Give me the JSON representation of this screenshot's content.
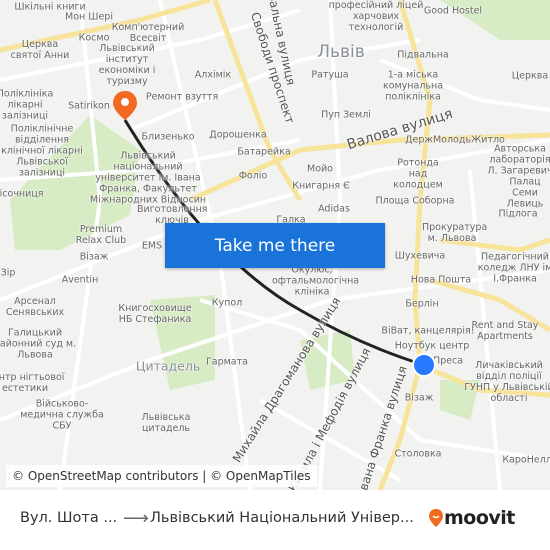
{
  "map": {
    "labels": [
      "Шкільні книги",
      "Мон Шері",
      "Комп'ютерний Всесвіт",
      "Космо",
      "Церква святої Анни",
      "Львівський інститут економіки і туризму",
      "Алхімік",
      "Поліклініка лікарні залізниці",
      "Satirikon",
      "Ремонт взуття",
      "Поліклінічне відділення клінічної лікарні Львівської залізниці",
      "Близенько",
      "Дорошенка",
      "Батарейка",
      "Львівський національний університет ім. Івана Франка, Факультет Міжнародних Відносин",
      "Фоліо",
      "Пісочниця",
      "Виготовлення ключів",
      "Premium Relax Club",
      "EMS",
      "Візаж",
      "Аventін",
      "Арсенал Сенявських",
      "Галицький районний суд м. Львова",
      "Центр нігтьової естетики",
      "Військово-медична служба СБУ",
      "Книгосховище НБ Стефаника",
      "Купол",
      "Цитадель",
      "Гармата",
      "Львівська цитадель",
      "Львівський професійний ліцей харчових технологій",
      "Good Hostel",
      "Львів",
      "Підвальна",
      "Ратуша",
      "1-а міська комунальна поліклініка",
      "Пуп Землі",
      "ДержМолодьЖитло",
      "Мойо",
      "Ротонда над колодцем",
      "Книгарня Є",
      "Площа Соборна",
      "Adidas",
      "Галка",
      "Прокуратура м. Львова",
      "Підлога",
      "Авторська лабораторія Л. Загаревич",
      "Палац Семи Левиць",
      "Церква",
      "Шухевича",
      "Педагогічний коледж ЛНУ ім І.Франка",
      "Окулюс, офтальмологічна клініка",
      "Нова Пошта",
      "Берлін",
      "ВіВат, канцелярія!",
      "Rent and Stay Apartments",
      "Ноутбук центр",
      "Преса",
      "Личаківський відділ поліції ГУНП у Львівській області",
      "Візаж",
      "Столовка",
      "КароНелла",
      "Зір"
    ],
    "streets": [
      "Свободи проспект",
      "Театральна вулиця",
      "Валова вулиця",
      "Михайла Драгоманова вулиця",
      "Кирила і Мефодія вулиця",
      "Івана Франка вулиця"
    ],
    "origin_icon": "blue-dot-icon",
    "destination_icon": "orange-pin-icon",
    "route_color": "#222222",
    "attribution": "© OpenStreetMap contributors | © OpenMapTiles"
  },
  "cta": {
    "label": "Take me there",
    "color": "#1a73d8"
  },
  "bottom": {
    "from": "Вул. Шота ...",
    "to": "Львівський Національний Універ...",
    "brand": "moovit",
    "brand_color": "#f26a21"
  }
}
